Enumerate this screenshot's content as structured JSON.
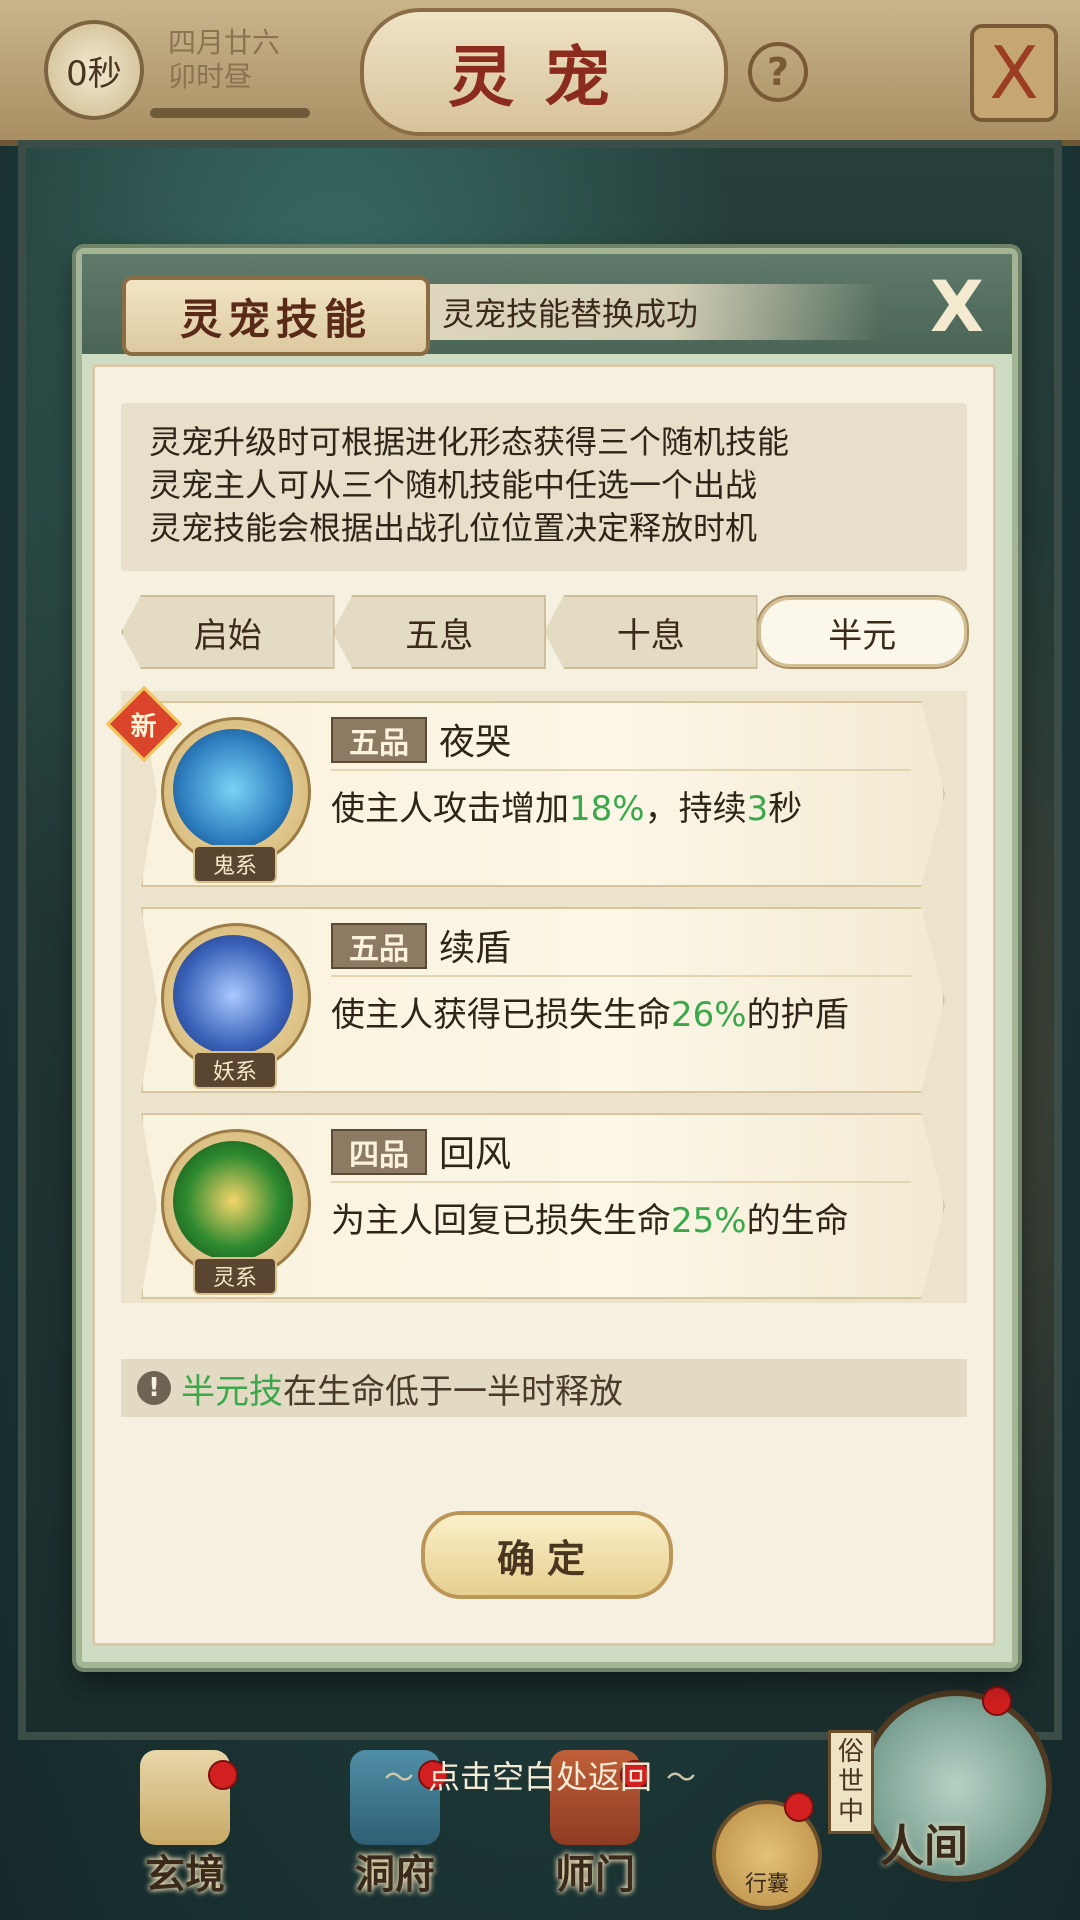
{
  "top_bar": {
    "timer": "0秒",
    "date_line1": "四月廿六",
    "date_line2": "卯时昼",
    "title": "灵宠",
    "help_icon": "?",
    "close_icon": "X"
  },
  "modal": {
    "tab_label": "灵宠技能",
    "toast": "灵宠技能替换成功",
    "close_icon": "X",
    "description": [
      "灵宠升级时可根据进化形态获得三个随机技能",
      "灵宠主人可从三个随机技能中任选一个出战",
      "灵宠技能会根据出战孔位位置决定释放时机"
    ],
    "tabs": [
      {
        "label": "启始",
        "active": false
      },
      {
        "label": "五息",
        "active": false
      },
      {
        "label": "十息",
        "active": false
      },
      {
        "label": "半元",
        "active": true
      }
    ],
    "skills": [
      {
        "is_new": true,
        "new_label": "新",
        "grade": "五品",
        "name": "夜哭",
        "type": "鬼系",
        "effect_prefix": "使主人攻击增加",
        "effect_value": "18%",
        "effect_mid": "，持续",
        "effect_value2": "3",
        "effect_suffix": "秒",
        "color": "#2e7fc0"
      },
      {
        "is_new": false,
        "grade": "五品",
        "name": "续盾",
        "type": "妖系",
        "effect_prefix": "使主人获得已损失生命",
        "effect_value": "26%",
        "effect_suffix": "的护盾",
        "color": "#3a62b8"
      },
      {
        "is_new": false,
        "grade": "四品",
        "name": "回风",
        "type": "灵系",
        "effect_prefix": "为主人回复已损失生命",
        "effect_value": "25%",
        "effect_suffix": "的生命",
        "color": "#2d8a2f"
      }
    ],
    "tip_icon": "!",
    "tip_highlight": "半元技",
    "tip_text": "在生命低于一半时释放",
    "confirm_label": "确定"
  },
  "return_hint": "点击空白处返回",
  "bottom_nav": {
    "items": [
      "玄境",
      "洞府",
      "师门"
    ],
    "bag": "行囊",
    "world": "人间",
    "world_vertical": "俗世中"
  }
}
